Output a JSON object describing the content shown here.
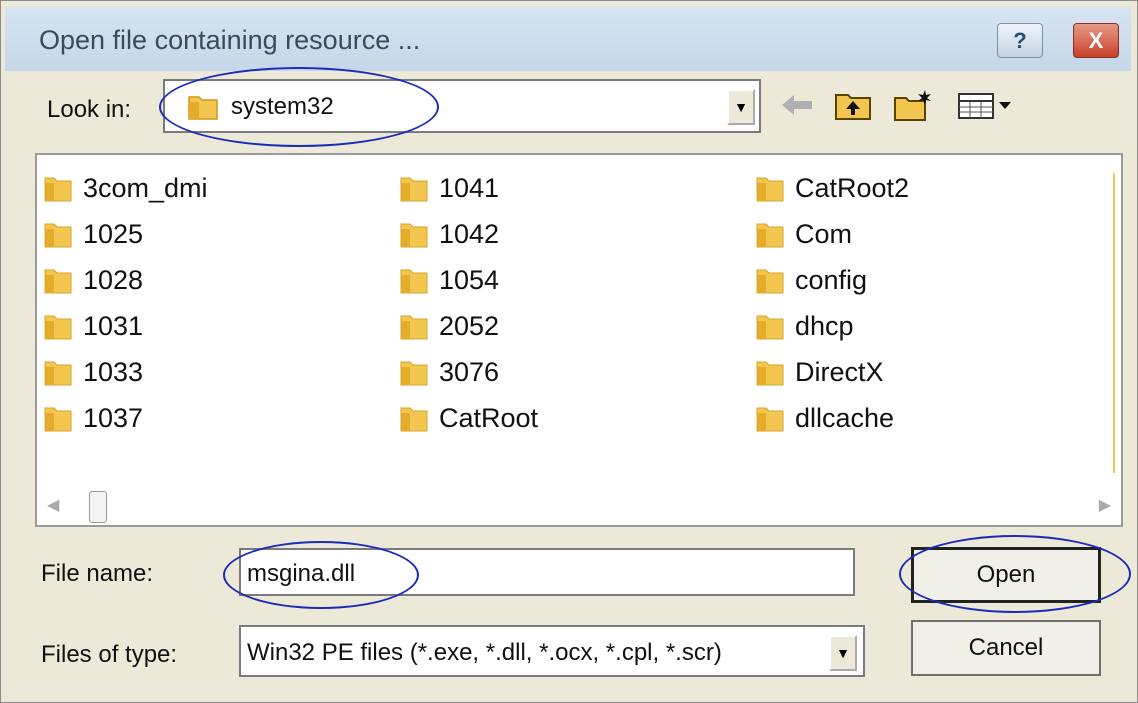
{
  "window": {
    "title": "Open file containing resource ..."
  },
  "titlebar_buttons": {
    "help": "?",
    "close": "X"
  },
  "lookin": {
    "label": "Look in:",
    "value": "system32",
    "icon": "folder-icon"
  },
  "toolbar": {
    "back_icon": "back-arrow-icon",
    "up_icon": "up-one-level-icon",
    "new_folder_icon": "new-folder-icon",
    "view_menu_icon": "view-menu-icon"
  },
  "files": {
    "columns": [
      [
        "3com_dmi",
        "1025",
        "1028",
        "1031",
        "1033",
        "1037"
      ],
      [
        "1041",
        "1042",
        "1054",
        "2052",
        "3076",
        "CatRoot"
      ],
      [
        "CatRoot2",
        "Com",
        "config",
        "dhcp",
        "DirectX",
        "dllcache"
      ]
    ]
  },
  "filename": {
    "label": "File name:",
    "value": "msgina.dll"
  },
  "filetype": {
    "label": "Files of type:",
    "value": "Win32 PE files (*.exe, *.dll, *.ocx, *.cpl, *.scr)"
  },
  "buttons": {
    "open": "Open",
    "cancel": "Cancel"
  },
  "colors": {
    "annotation_ellipse": "#1c2bb8",
    "folder": "#f3c74f",
    "titlebar": "#cbdaec"
  }
}
